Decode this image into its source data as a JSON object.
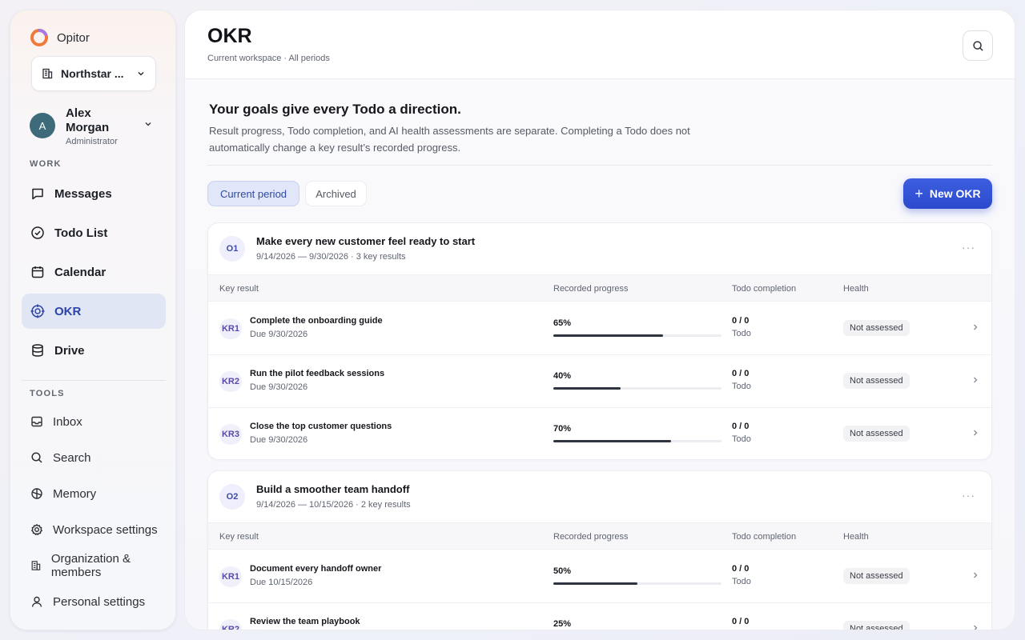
{
  "sidebar": {
    "brand": "Opitor",
    "workspace": "Northstar ...",
    "user": {
      "name": "Alex Morgan",
      "initial": "A",
      "role": "Administrator"
    },
    "work_label": "WORK",
    "nav": [
      {
        "label": "Messages",
        "icon": "message-icon"
      },
      {
        "label": "Todo List",
        "icon": "check-circle-icon"
      },
      {
        "label": "Calendar",
        "icon": "calendar-icon"
      },
      {
        "label": "OKR",
        "icon": "target-icon",
        "active": true
      },
      {
        "label": "Drive",
        "icon": "database-icon"
      }
    ],
    "tools_label": "TOOLS",
    "tools": [
      {
        "label": "Inbox",
        "icon": "inbox-icon"
      },
      {
        "label": "Search",
        "icon": "search-icon"
      },
      {
        "label": "Memory",
        "icon": "brain-icon"
      },
      {
        "label": "Workspace settings",
        "icon": "gear-icon"
      },
      {
        "label": "Organization & members",
        "icon": "building-icon"
      },
      {
        "label": "Personal settings",
        "icon": "user-icon"
      }
    ]
  },
  "header": {
    "title": "OKR",
    "subtitle": "Current workspace · All periods"
  },
  "intro": {
    "title": "Your goals give every Todo a direction.",
    "text": "Result progress, Todo completion, and AI health assessments are separate. Completing a Todo does not automatically change a key result’s recorded progress."
  },
  "tabs": {
    "current": "Current period",
    "archived": "Archived"
  },
  "new_button": {
    "plus": "+",
    "label": "New OKR"
  },
  "table_headers": {
    "key_result": "Key result",
    "progress": "Recorded progress",
    "todo": "Todo completion",
    "health": "Health"
  },
  "objectives": [
    {
      "badge": "O1",
      "title": "Make every new customer feel ready to start",
      "meta": "9/14/2026 — 9/30/2026 · 3 key results",
      "more": "···",
      "key_results": [
        {
          "badge": "KR1",
          "title": "Complete the onboarding guide",
          "due": "Due 9/30/2026",
          "progress_label": "65%",
          "progress": 0.65,
          "todo": "0 / 0",
          "todo_sub": "Todo",
          "health": "Not assessed"
        },
        {
          "badge": "KR2",
          "title": "Run the pilot feedback sessions",
          "due": "Due 9/30/2026",
          "progress_label": "40%",
          "progress": 0.4,
          "todo": "0 / 0",
          "todo_sub": "Todo",
          "health": "Not assessed"
        },
        {
          "badge": "KR3",
          "title": "Close the top customer questions",
          "due": "Due 9/30/2026",
          "progress_label": "70%",
          "progress": 0.7,
          "todo": "0 / 0",
          "todo_sub": "Todo",
          "health": "Not assessed"
        }
      ]
    },
    {
      "badge": "O2",
      "title": "Build a smoother team handoff",
      "meta": "9/14/2026 — 10/15/2026 · 2 key results",
      "more": "···",
      "key_results": [
        {
          "badge": "KR1",
          "title": "Document every handoff owner",
          "due": "Due 10/15/2026",
          "progress_label": "50%",
          "progress": 0.5,
          "todo": "0 / 0",
          "todo_sub": "Todo",
          "health": "Not assessed"
        },
        {
          "badge": "KR2",
          "title": "Review the team playbook",
          "due": "",
          "progress_label": "25%",
          "progress": 0.25,
          "todo": "0 / 0",
          "todo_sub": "",
          "health": "Not assessed"
        }
      ]
    }
  ],
  "colors": {
    "accent": "#2c49cc",
    "active_nav_bg": "#e1e6f5",
    "avatar": "#3e6b7a"
  }
}
